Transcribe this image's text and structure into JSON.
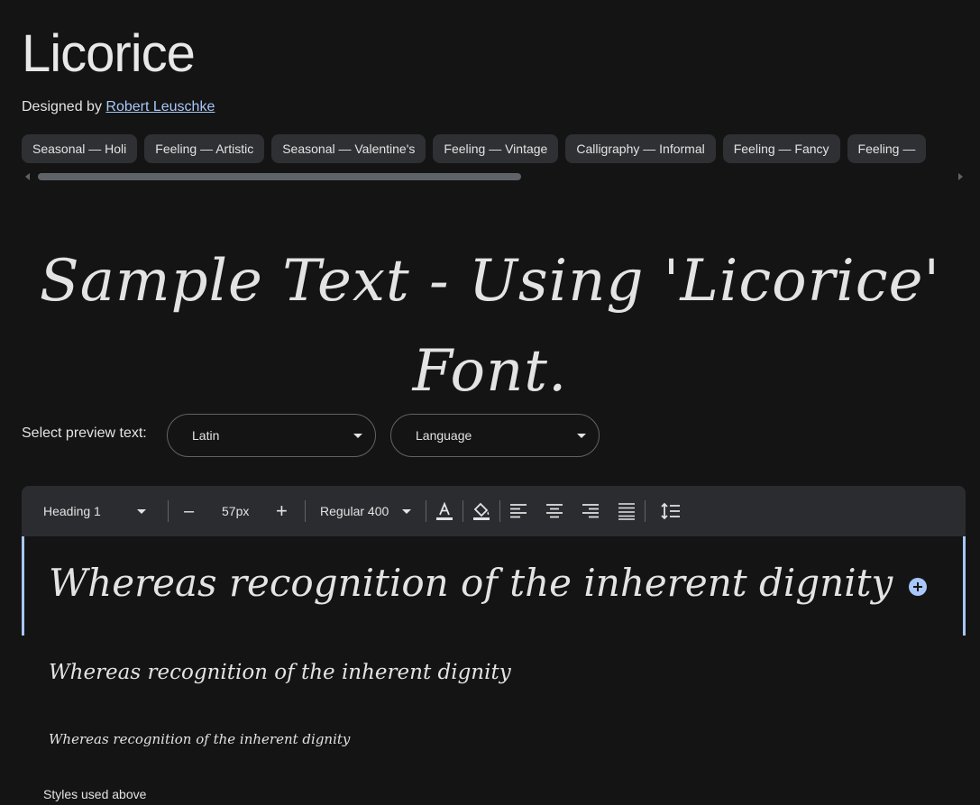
{
  "font": {
    "name": "Licorice",
    "designed_by_prefix": "Designed by ",
    "designer": "Robert Leuschke"
  },
  "tags": [
    "Seasonal — Holi",
    "Feeling — Artistic",
    "Seasonal — Valentine's",
    "Feeling — Vintage",
    "Calligraphy — Informal",
    "Feeling — Fancy",
    "Feeling —"
  ],
  "sample_text": "Sample Text - Using 'Licorice' Font.",
  "preview_select": {
    "label": "Select preview text:",
    "script_value": "Latin",
    "language_value": "Language"
  },
  "toolbar": {
    "style_value": "Heading 1",
    "decrease_label": "–",
    "size_value": "57px",
    "increase_label": "+",
    "weight_value": "Regular 400"
  },
  "preview_lines": {
    "main": "Whereas recognition of the inherent dignity",
    "second": "Whereas recognition of the inherent dignity",
    "third": "Whereas recognition of the inherent dignity"
  },
  "styles_used_label": "Styles used above",
  "colors": {
    "background": "#141414",
    "accent": "#a8c7fa",
    "chip": "#2f3033",
    "toolbar": "#2b2c2f"
  }
}
